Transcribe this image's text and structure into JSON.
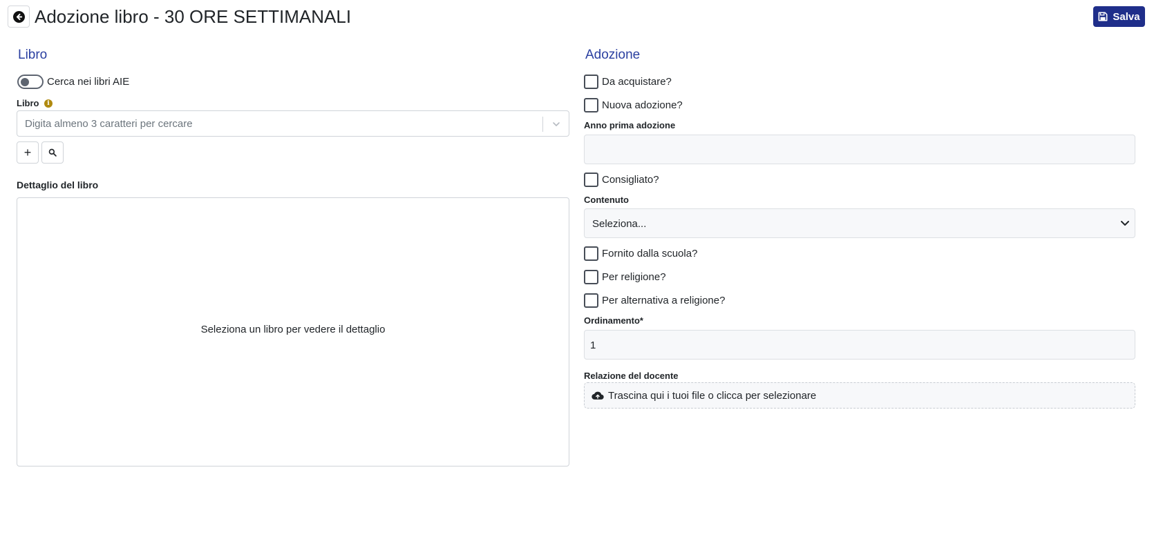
{
  "header": {
    "back_icon": "arrow-left-circle-icon",
    "title": "Adozione libro - 30 ORE SETTIMANALI",
    "save_label": "Salva",
    "save_icon": "floppy-disk-icon",
    "accent_color": "#1f2e8a"
  },
  "libro": {
    "section_title": "Libro",
    "toggle_label": "Cerca nei libri AIE",
    "toggle_on": false,
    "field_label": "Libro",
    "info_icon": "info-icon",
    "search_placeholder": "Digita almeno 3 caratteri per cercare",
    "add_icon": "plus-icon",
    "search_icon": "search-icon",
    "add_glyph": "+",
    "detail_title": "Dettaglio del libro",
    "detail_empty": "Seleziona un libro per vedere il dettaglio"
  },
  "adozione": {
    "section_title": "Adozione",
    "da_acquistare": "Da acquistare?",
    "nuova_adozione": "Nuova adozione?",
    "anno_label": "Anno prima adozione",
    "anno_value": "",
    "consigliato": "Consigliato?",
    "contenuto_label": "Contenuto",
    "contenuto_value": "Seleziona...",
    "fornito": "Fornito dalla scuola?",
    "religione": "Per religione?",
    "alternativa": "Per alternativa a religione?",
    "ordinamento_label": "Ordinamento*",
    "ordinamento_value": "1",
    "relazione_label": "Relazione del docente",
    "upload_icon": "cloud-upload-icon",
    "dropzone_text": "Trascina qui i tuoi file o clicca per selezionare"
  }
}
